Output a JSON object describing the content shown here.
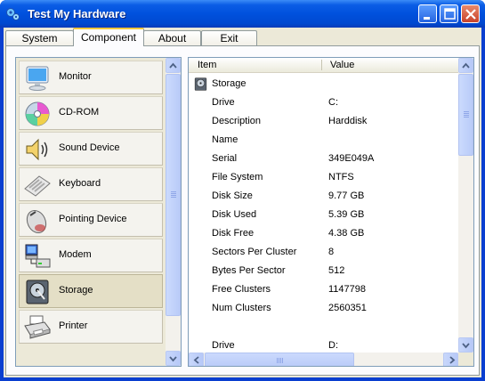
{
  "window": {
    "title": "Test My Hardware"
  },
  "tabs": [
    {
      "label": "System"
    },
    {
      "label": "Component"
    },
    {
      "label": "About"
    },
    {
      "label": "Exit"
    }
  ],
  "active_tab": "Component",
  "categories": [
    {
      "label": "Monitor",
      "icon": "monitor-icon"
    },
    {
      "label": "CD-ROM",
      "icon": "cdrom-icon"
    },
    {
      "label": "Sound Device",
      "icon": "speaker-icon"
    },
    {
      "label": "Keyboard",
      "icon": "keyboard-icon"
    },
    {
      "label": "Pointing Device",
      "icon": "mouse-icon"
    },
    {
      "label": "Modem",
      "icon": "modem-icon"
    },
    {
      "label": "Storage",
      "icon": "hard-disk-icon"
    },
    {
      "label": "Printer",
      "icon": "printer-icon"
    }
  ],
  "selected_category": "Storage",
  "listview": {
    "columns": [
      "Item",
      "Value"
    ],
    "group_label": "Storage",
    "rows": [
      {
        "item": "Drive",
        "value": "C:"
      },
      {
        "item": "Description",
        "value": "Harddisk"
      },
      {
        "item": "Name",
        "value": ""
      },
      {
        "item": "Serial",
        "value": "349E049A"
      },
      {
        "item": "File System",
        "value": "NTFS"
      },
      {
        "item": "Disk Size",
        "value": "9.77 GB"
      },
      {
        "item": "Disk Used",
        "value": "5.39 GB"
      },
      {
        "item": "Disk Free",
        "value": "4.38 GB"
      },
      {
        "item": "Sectors Per Cluster",
        "value": "8"
      },
      {
        "item": "Bytes Per Sector",
        "value": "512"
      },
      {
        "item": "Free Clusters",
        "value": "1147798"
      },
      {
        "item": "Num Clusters",
        "value": "2560351"
      },
      {
        "item": "",
        "value": ""
      },
      {
        "item": "Drive",
        "value": "D:"
      }
    ]
  },
  "colors": {
    "titlebar": "#0054e3",
    "tab_highlight": "#ffc83c",
    "panel_border": "#7f9db9"
  }
}
